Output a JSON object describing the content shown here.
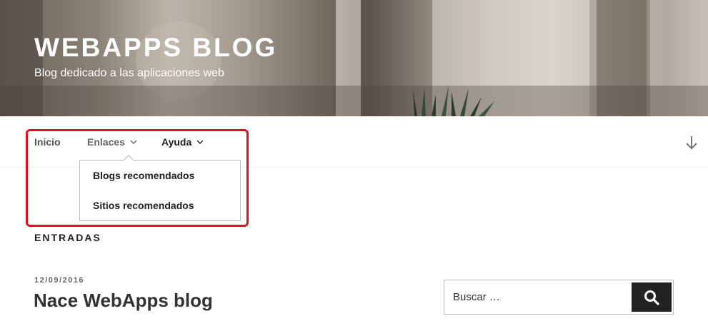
{
  "header": {
    "site_title": "WEBAPPS BLOG",
    "site_description": "Blog dedicado a las aplicaciones web"
  },
  "nav": {
    "items": [
      {
        "label": "Inicio"
      },
      {
        "label": "Enlaces",
        "icon": "chevron-down-icon"
      },
      {
        "label": "Ayuda",
        "icon": "chevron-down-icon"
      }
    ],
    "dropdown": {
      "items": [
        {
          "label": "Blogs recomendados"
        },
        {
          "label": "Sitios recomendados"
        }
      ]
    },
    "scroll_icon": "arrow-down-icon"
  },
  "main": {
    "section_title": "ENTRADAS",
    "posts": [
      {
        "date": "12/09/2016",
        "title": "Nace WebApps blog"
      }
    ]
  },
  "search": {
    "placeholder": "Buscar …",
    "button_icon": "search-icon"
  },
  "colors": {
    "highlight": "#e0111c",
    "search_button": "#222222"
  }
}
